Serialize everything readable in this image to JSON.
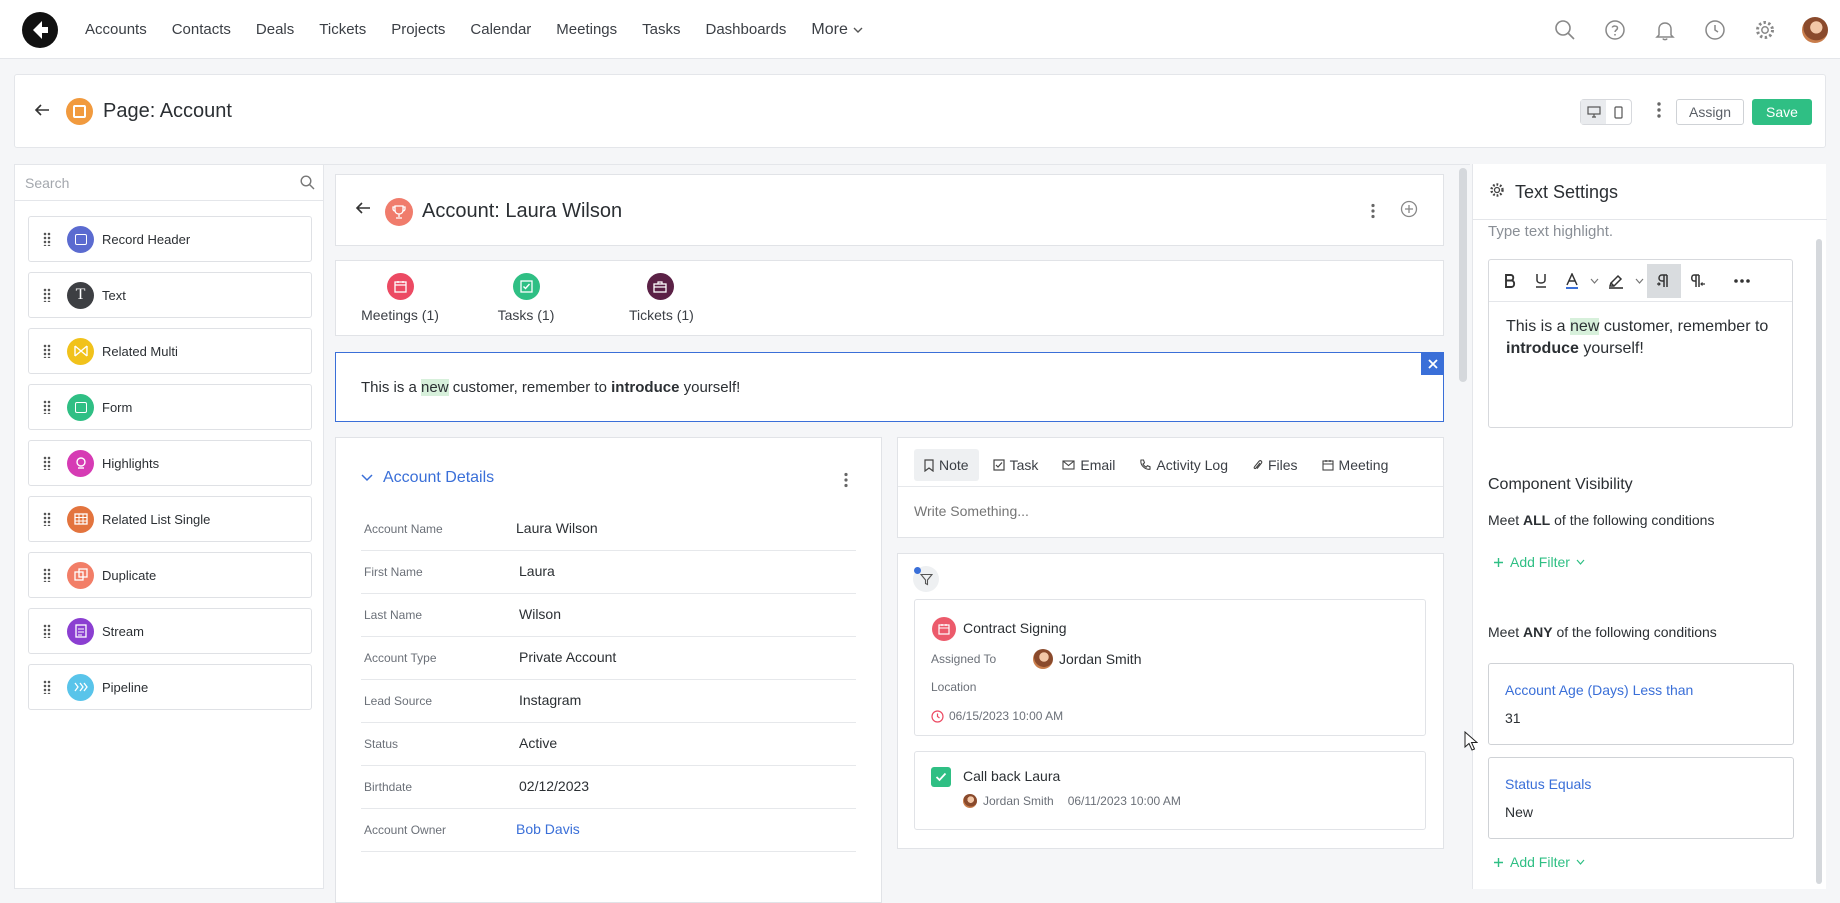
{
  "nav": {
    "links": [
      "Accounts",
      "Contacts",
      "Deals",
      "Tickets",
      "Projects",
      "Calendar",
      "Meetings",
      "Tasks",
      "Dashboards"
    ],
    "more": "More"
  },
  "page": {
    "title": "Page: Account",
    "assign": "Assign",
    "save": "Save"
  },
  "library": {
    "search_placeholder": "Search",
    "components": [
      {
        "label": "Record Header",
        "color": "#5b6bd0"
      },
      {
        "label": "Text",
        "color": "#3d3f43"
      },
      {
        "label": "Related Multi",
        "color": "#f1c21b"
      },
      {
        "label": "Form",
        "color": "#2fbf84"
      },
      {
        "label": "Highlights",
        "color": "#d63bb4"
      },
      {
        "label": "Related List Single",
        "color": "#e3743e"
      },
      {
        "label": "Duplicate",
        "color": "#f27e67"
      },
      {
        "label": "Stream",
        "color": "#8b3fd1"
      },
      {
        "label": "Pipeline",
        "color": "#59c4ea"
      }
    ]
  },
  "record": {
    "title": "Account: Laura Wilson",
    "related": [
      {
        "label": "Meetings (1)",
        "color": "#ec4a63"
      },
      {
        "label": "Tasks (1)",
        "color": "#2fbf84"
      },
      {
        "label": "Tickets (1)",
        "color": "#5b2146"
      }
    ],
    "note": {
      "pre": "This is a ",
      "highlight": "new",
      "mid": " customer, remember to ",
      "bold": "introduce",
      "post": " yourself!"
    }
  },
  "details": {
    "title": "Account Details",
    "fields": [
      {
        "label": "Account Name",
        "value": "Laura Wilson"
      },
      {
        "label": "First Name",
        "value": "Laura"
      },
      {
        "label": "Last Name",
        "value": "Wilson"
      },
      {
        "label": "Account Type",
        "value": "Private Account"
      },
      {
        "label": "Lead Source",
        "value": "Instagram"
      },
      {
        "label": "Status",
        "value": "Active"
      },
      {
        "label": "Birthdate",
        "value": "02/12/2023"
      },
      {
        "label": "Account Owner",
        "value": "Bob Davis"
      }
    ]
  },
  "composer": {
    "tabs": [
      "Note",
      "Task",
      "Email",
      "Activity Log",
      "Files",
      "Meeting"
    ],
    "placeholder": "Write Something..."
  },
  "stream": {
    "meeting": {
      "title": "Contract Signing",
      "assigned_label": "Assigned To",
      "assignee": "Jordan Smith",
      "location_label": "Location",
      "date": "06/15/2023 10:00 AM"
    },
    "task": {
      "title": "Call back Laura",
      "assignee": "Jordan Smith",
      "date": "06/11/2023 10:00 AM"
    }
  },
  "settings": {
    "title": "Text Settings",
    "hint": "Type text highlight.",
    "editor": {
      "pre": "This is a ",
      "highlight": "new",
      "mid": " customer, remember to ",
      "bold": "introduce",
      "post": " yourself!"
    },
    "visibility_title": "Component Visibility",
    "all_pre": "Meet ",
    "all_bold": "ALL",
    "all_post": " of the following conditions",
    "any_pre": "Meet ",
    "any_bold": "ANY",
    "any_post": " of the following conditions",
    "add_filter": "Add Filter",
    "conditions": [
      {
        "title": "Account Age (Days) Less than",
        "value": "31"
      },
      {
        "title": "Status Equals",
        "value": "New"
      }
    ]
  }
}
